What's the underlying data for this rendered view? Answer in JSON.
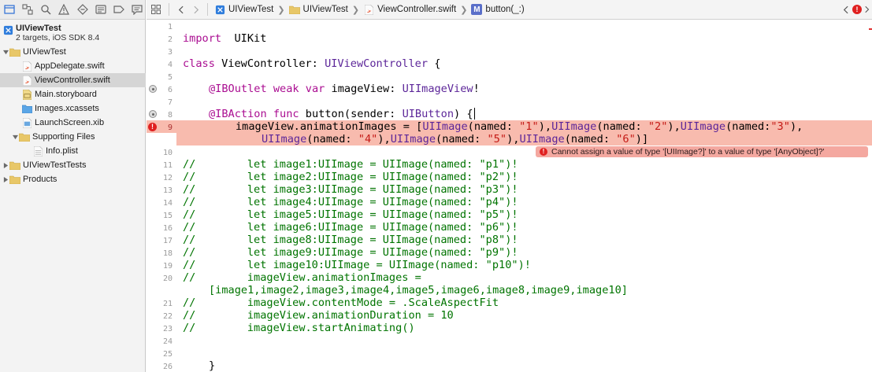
{
  "navigator": {
    "toolbar_icons": [
      "project-navigator-icon",
      "symbol-navigator-icon",
      "find-navigator-icon",
      "issue-navigator-icon",
      "test-navigator-icon",
      "debug-navigator-icon",
      "breakpoint-navigator-icon",
      "report-navigator-icon"
    ],
    "project": {
      "title": "UIViewTest",
      "subtitle": "2 targets, iOS SDK 8.4"
    },
    "items": [
      {
        "label": "UIViewTest",
        "kind": "group"
      },
      {
        "label": "AppDelegate.swift",
        "kind": "swift"
      },
      {
        "label": "ViewController.swift",
        "kind": "swift",
        "selected": true
      },
      {
        "label": "Main.storyboard",
        "kind": "storyboard"
      },
      {
        "label": "Images.xcassets",
        "kind": "assets"
      },
      {
        "label": "LaunchScreen.xib",
        "kind": "xib"
      },
      {
        "label": "Supporting Files",
        "kind": "group"
      },
      {
        "label": "Info.plist",
        "kind": "plist"
      },
      {
        "label": "UIViewTestTests",
        "kind": "group"
      },
      {
        "label": "Products",
        "kind": "group"
      }
    ]
  },
  "jumpbar": {
    "crumbs": [
      "UIViewTest",
      "UIViewTest",
      "ViewController.swift",
      "button(_:)"
    ],
    "method_badge": "M"
  },
  "editor": {
    "line_numbers": [
      "1",
      "2",
      "3",
      "4",
      "5",
      "6",
      "7",
      "8",
      "9",
      "10",
      "11",
      "12",
      "13",
      "14",
      "15",
      "16",
      "17",
      "18",
      "19",
      "20",
      "",
      "21",
      "22",
      "23",
      "24",
      "25",
      "26"
    ],
    "error_message": "Cannot assign a value of type '[UIImage?]' to a value of type '[AnyObject]?'",
    "error_glyph": "!"
  },
  "colors": {
    "error_highlight": "#f8bbae",
    "error_bubble": "#f4a8a0",
    "keyword": "#aa0d91",
    "type": "#5c2699",
    "string": "#c41a16",
    "comment": "#007400"
  }
}
